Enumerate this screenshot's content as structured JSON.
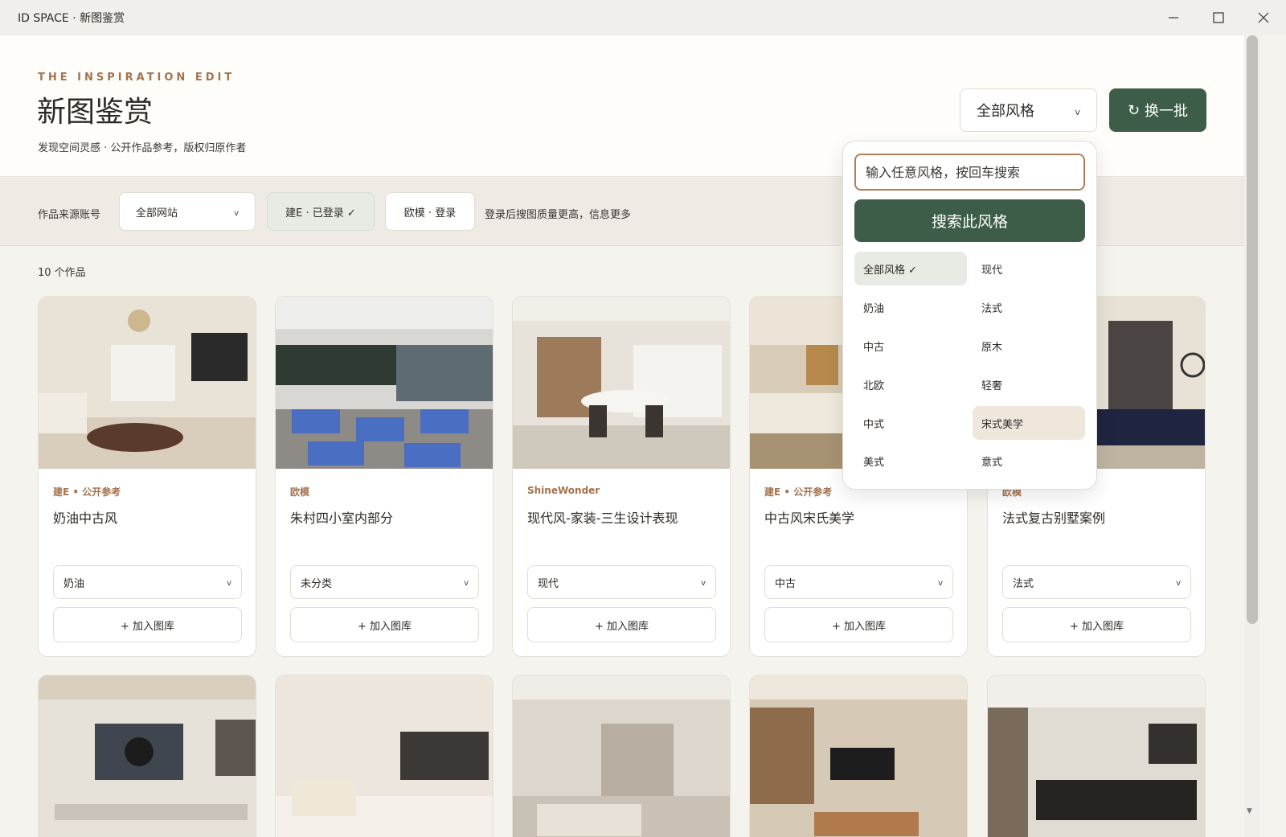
{
  "window": {
    "title": "ID SPACE · 新图鉴赏"
  },
  "header": {
    "eyebrow": "THE INSPIRATION EDIT",
    "title": "新图鉴赏",
    "subtitle": "发现空间灵感 · 公开作品参考，版权归原作者",
    "style_select": "全部风格",
    "refresh_label": "换一批"
  },
  "filters": {
    "label": "作品来源账号",
    "site_select": "全部网站",
    "account_a": "建E · 已登录 ✓",
    "account_b": "欧模 · 登录",
    "hint": "登录后搜图质量更高，信息更多"
  },
  "count": "10 个作品",
  "dropdown": {
    "search_placeholder": "输入任意风格，按回车搜索",
    "search_button": "搜索此风格",
    "options": [
      "全部风格 ✓",
      "现代",
      "奶油",
      "法式",
      "中古",
      "原木",
      "北欧",
      "轻奢",
      "中式",
      "宋式美学",
      "美式",
      "意式"
    ],
    "selected": "全部风格",
    "hovered": "宋式美学"
  },
  "cards": [
    {
      "source": "建E • 公开参考",
      "title": "奶油中古风",
      "category": "奶油",
      "add_label": "+ 加入图库"
    },
    {
      "source": "欧模",
      "title": "朱村四小室内部分",
      "category": "未分类",
      "add_label": "+ 加入图库"
    },
    {
      "source": "ShineWonder",
      "title": "现代风-家装-三生设计表现",
      "category": "现代",
      "add_label": "+ 加入图库"
    },
    {
      "source": "建E • 公开参考",
      "title": "中古风宋氏美学",
      "category": "中古",
      "add_label": "+ 加入图库"
    },
    {
      "source": "欧模",
      "title": "法式复古别墅案例",
      "category": "法式",
      "add_label": "+ 加入图库"
    }
  ],
  "colors": {
    "accent_green": "#3d5d48",
    "accent_brown": "#a3734e",
    "selected_bg": "#e6ebe3",
    "hover_bg": "#efe6dc"
  },
  "icons": {
    "refresh": "refresh-icon",
    "chevron": "chevron-down-icon",
    "minimize": "minimize-icon",
    "maximize": "maximize-icon",
    "close": "close-icon"
  }
}
